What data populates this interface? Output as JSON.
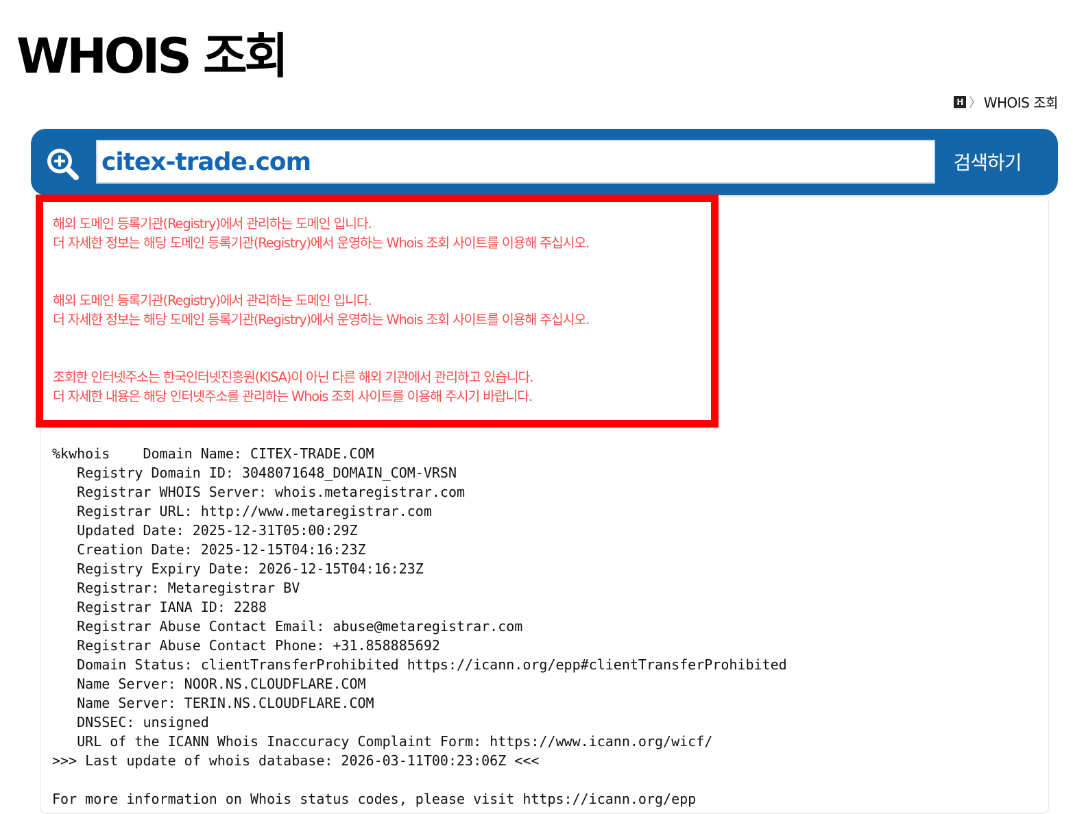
{
  "page_title": "WHOIS 조회",
  "breadcrumb": {
    "home_icon_letter": "H",
    "separator": "〉",
    "current": "WHOIS 조회"
  },
  "search": {
    "value": "citex-trade.com",
    "button_label": "검색하기"
  },
  "notices": [
    {
      "line1": "해외 도메인 등록기관(Registry)에서 관리하는 도메인 입니다.",
      "line2": "더 자세한 정보는 해당 도메인 등록기관(Registry)에서 운영하는 Whois 조회 사이트를 이용해 주십시오."
    },
    {
      "line1": "해외 도메인 등록기관(Registry)에서 관리하는 도메인 입니다.",
      "line2": "더 자세한 정보는 해당 도메인 등록기관(Registry)에서 운영하는 Whois 조회 사이트를 이용해 주십시오."
    },
    {
      "line1": "조회한 인터넷주소는 한국인터넷진흥원(KISA)이 아닌 다른 해외 기관에서 관리하고 있습니다.",
      "line2": "더 자세한 내용은 해당 인터넷주소를 관리하는 Whois 조회 사이트를 이용해 주시기 바랍니다."
    }
  ],
  "whois_lines": [
    "%kwhois    Domain Name: CITEX-TRADE.COM",
    "   Registry Domain ID: 3048071648_DOMAIN_COM-VRSN",
    "   Registrar WHOIS Server: whois.metaregistrar.com",
    "   Registrar URL: http://www.metaregistrar.com",
    "   Updated Date: 2025-12-31T05:00:29Z",
    "   Creation Date: 2025-12-15T04:16:23Z",
    "   Registry Expiry Date: 2026-12-15T04:16:23Z",
    "   Registrar: Metaregistrar BV",
    "   Registrar IANA ID: 2288",
    "   Registrar Abuse Contact Email: abuse@metaregistrar.com",
    "   Registrar Abuse Contact Phone: +31.858885692",
    "   Domain Status: clientTransferProhibited https://icann.org/epp#clientTransferProhibited",
    "   Name Server: NOOR.NS.CLOUDFLARE.COM",
    "   Name Server: TERIN.NS.CLOUDFLARE.COM",
    "   DNSSEC: unsigned",
    "   URL of the ICANN Whois Inaccuracy Complaint Form: https://www.icann.org/wicf/",
    ">>> Last update of whois database: 2026-03-11T00:23:06Z <<<",
    "",
    "For more information on Whois status codes, please visit https://icann.org/epp"
  ],
  "colors": {
    "search_bar": "#1566a8",
    "search_text": "#1366b4",
    "notice_border": "#ff0000",
    "notice_text": "#ff4d4d"
  },
  "icons": {
    "search": "magnifier-plus-icon",
    "home": "home-icon"
  }
}
